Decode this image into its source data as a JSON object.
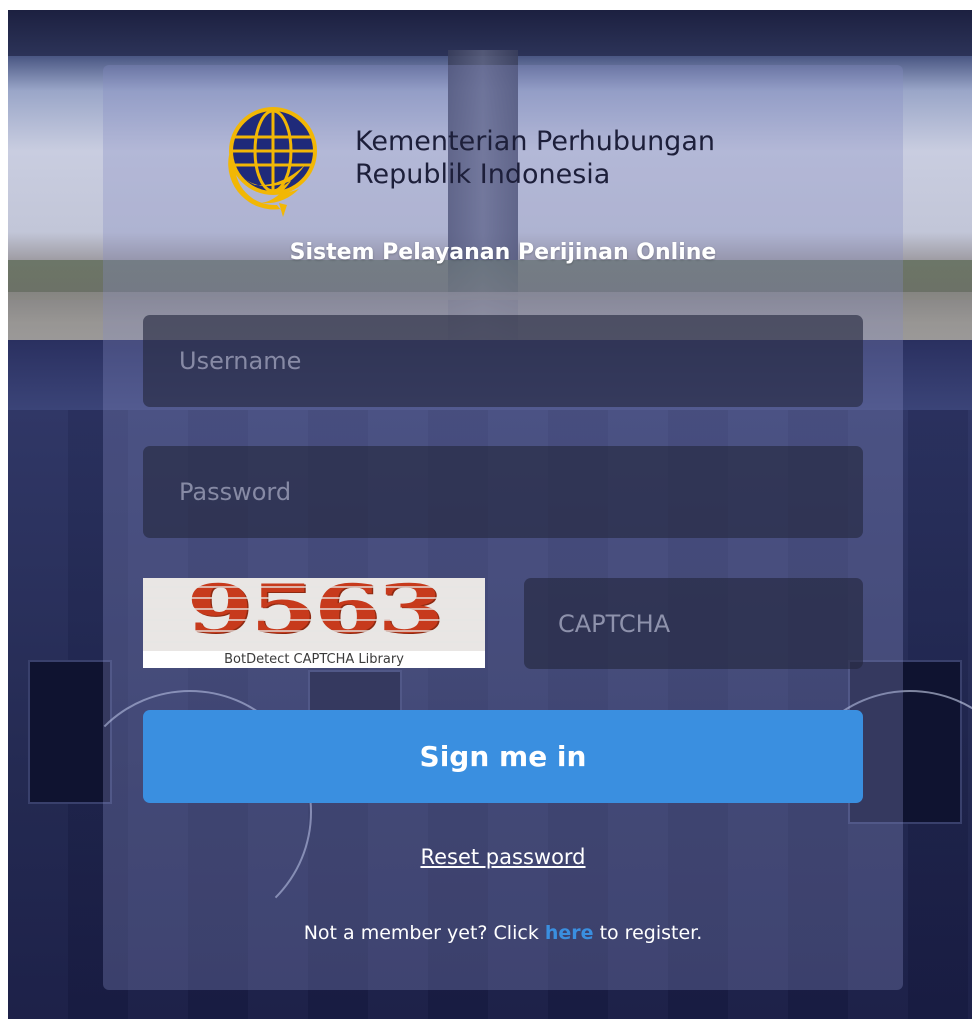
{
  "brand": {
    "line1": "Kementerian Perhubungan",
    "line2": "Republik Indonesia"
  },
  "subtitle": "Sistem Pelayanan Perijinan Online",
  "form": {
    "username_placeholder": "Username",
    "username_value": "",
    "password_placeholder": "Password",
    "password_value": "",
    "captcha_code": "9563",
    "captcha_caption": "BotDetect CAPTCHA Library",
    "captcha_placeholder": "CAPTCHA",
    "captcha_value": "",
    "signin_label": "Sign me in"
  },
  "links": {
    "reset_label": "Reset password",
    "register_prefix": "Not a member yet? Click ",
    "register_link": "here",
    "register_suffix": " to register."
  },
  "colors": {
    "accent": "#3a8fe0",
    "logo_navy": "#1f2a7a",
    "logo_gold": "#f2b705",
    "captcha_red": "#c73a1c"
  }
}
